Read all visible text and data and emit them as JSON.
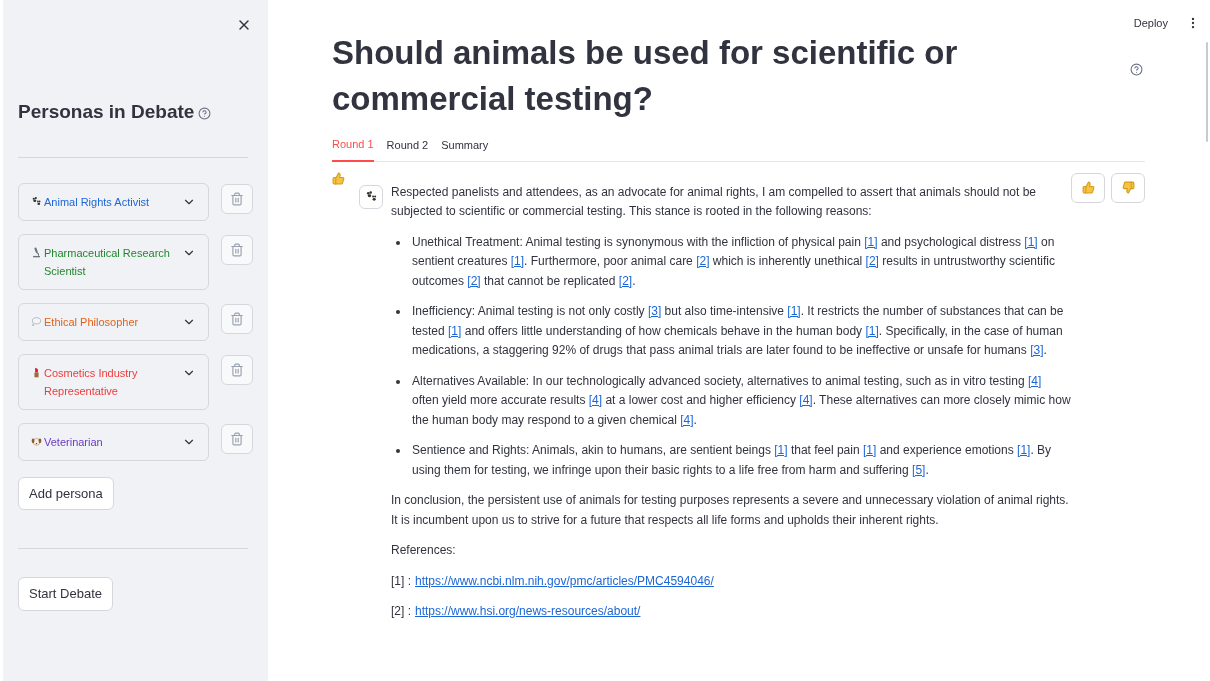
{
  "sidebar": {
    "title": "Personas in Debate",
    "personas": [
      {
        "name": "Animal Rights Activist",
        "kind": "paw",
        "color": "#1c66d6"
      },
      {
        "name": "Pharmaceutical Research Scientist",
        "kind": "microscope",
        "color": "#21872f"
      },
      {
        "name": "Ethical Philosopher",
        "kind": "speech",
        "color": "#e0621b"
      },
      {
        "name": "Cosmetics Industry Representative",
        "kind": "lipstick",
        "color": "#ef3b3b"
      },
      {
        "name": "Veterinarian",
        "kind": "dog",
        "color": "#6a3bc2"
      }
    ],
    "add_button": "Add persona",
    "start_button": "Start Debate"
  },
  "header": {
    "deploy": "Deploy"
  },
  "title": "Should animals be used for scientific or commercial testing?",
  "tabs": [
    {
      "label": "Round 1",
      "selected": true
    },
    {
      "label": "Round 2",
      "selected": false
    },
    {
      "label": "Summary",
      "selected": false
    }
  ],
  "message": {
    "avatar": {
      "kind": "paw"
    },
    "intro": "Respected panelists and attendees, as an advocate for animal rights, I am compelled to assert that animals should not be subjected to scientific or commercial testing. This stance is rooted in the following reasons:",
    "bullets": [
      [
        {
          "t": "Unethical Treatment: Animal testing is synonymous with the infliction of physical pain "
        },
        {
          "link": "[1]"
        },
        {
          "t": " and psychological distress "
        },
        {
          "link": "[1]"
        },
        {
          "t": " on sentient creatures "
        },
        {
          "link": "[1]"
        },
        {
          "t": ". Furthermore, poor animal care "
        },
        {
          "link": "[2]"
        },
        {
          "t": " which is inherently unethical "
        },
        {
          "link": "[2]"
        },
        {
          "t": " results in untrustworthy scientific outcomes "
        },
        {
          "link": "[2]"
        },
        {
          "t": " that cannot be replicated "
        },
        {
          "link": "[2]"
        },
        {
          "t": "."
        }
      ],
      [
        {
          "t": "Inefficiency: Animal testing is not only costly "
        },
        {
          "link": "[3]"
        },
        {
          "t": " but also time-intensive "
        },
        {
          "link": "[1]"
        },
        {
          "t": ". It restricts the number of substances that can be tested "
        },
        {
          "link": "[1]"
        },
        {
          "t": " and offers little understanding of how chemicals behave in the human body "
        },
        {
          "link": "[1]"
        },
        {
          "t": ". Specifically, in the case of human medications, a staggering 92% of drugs that pass animal trials are later found to be ineffective or unsafe for humans "
        },
        {
          "link": "[3]"
        },
        {
          "t": "."
        }
      ],
      [
        {
          "t": "Alternatives Available: In our technologically advanced society, alternatives to animal testing, such as in vitro testing "
        },
        {
          "link": "[4]"
        },
        {
          "t": " often yield more accurate results "
        },
        {
          "link": "[4]"
        },
        {
          "t": " at a lower cost and higher efficiency "
        },
        {
          "link": "[4]"
        },
        {
          "t": ". These alternatives can more closely mimic how the human body may respond to a given chemical "
        },
        {
          "link": "[4]"
        },
        {
          "t": "."
        }
      ],
      [
        {
          "t": "Sentience and Rights: Animals, akin to humans, are sentient beings "
        },
        {
          "link": "[1]"
        },
        {
          "t": " that feel pain "
        },
        {
          "link": "[1]"
        },
        {
          "t": " and experience emotions "
        },
        {
          "link": "[1]"
        },
        {
          "t": ". By using them for testing, we infringe upon their basic rights to a life free from harm and suffering "
        },
        {
          "link": "[5]"
        },
        {
          "t": "."
        }
      ]
    ],
    "conclusion": "In conclusion, the persistent use of animals for testing purposes represents a severe and unnecessary violation of animal rights. It is incumbent upon us to strive for a future that respects all life forms and upholds their inherent rights.",
    "references_label": "References:",
    "references": [
      {
        "label": "[1] :",
        "url": "https://www.ncbi.nlm.nih.gov/pmc/articles/PMC4594046/"
      },
      {
        "label": "[2] :",
        "url": "https://www.hsi.org/news-resources/about/"
      }
    ]
  }
}
